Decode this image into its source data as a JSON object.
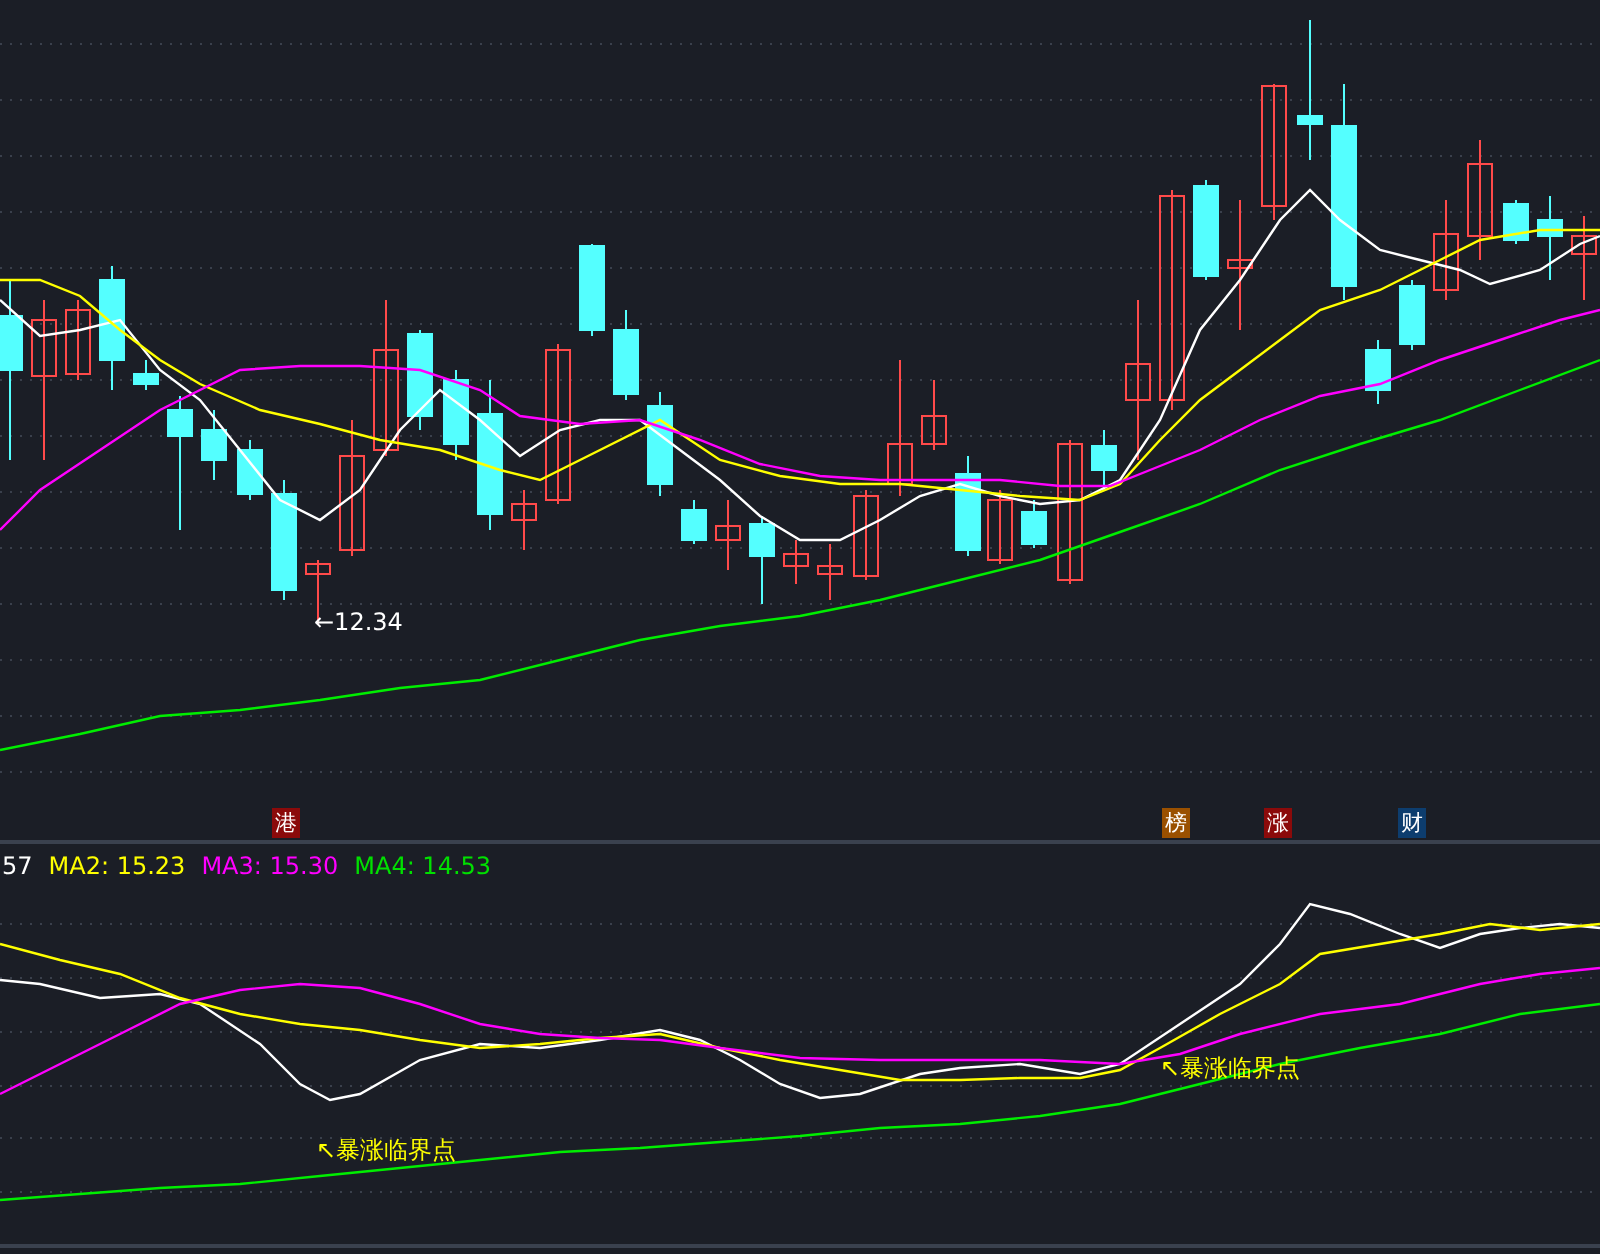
{
  "main_chart": {
    "low_label": "←12.34",
    "event_tags": [
      {
        "label": "港",
        "color": "#8b0a0a"
      },
      {
        "label": "榜",
        "color": "#9a5000"
      },
      {
        "label": "涨",
        "color": "#8b0a0a"
      },
      {
        "label": "财",
        "color": "#0d3d6e"
      }
    ]
  },
  "indicator_legend": [
    {
      "text": "57",
      "color": "#ffffff"
    },
    {
      "text": "MA2: 15.23",
      "color": "#ffff00"
    },
    {
      "text": "MA3: 15.30",
      "color": "#ff00ff"
    },
    {
      "text": "MA4: 14.53",
      "color": "#00e000"
    }
  ],
  "indicator_chart": {
    "annotations": [
      {
        "text": "↖暴涨临界点"
      },
      {
        "text": "↖暴涨临界点"
      }
    ]
  }
}
